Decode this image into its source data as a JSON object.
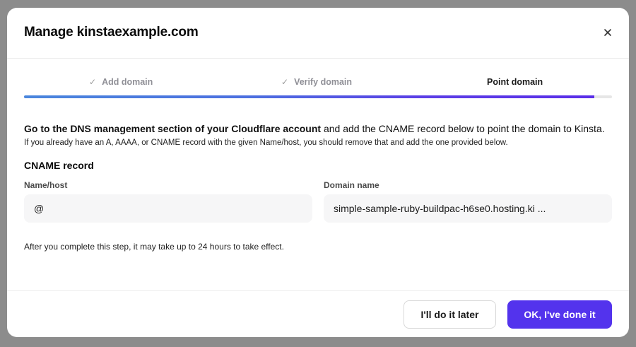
{
  "modal": {
    "title": "Manage kinstaexample.com",
    "close_icon": "close-icon"
  },
  "steps": [
    {
      "label": "Add domain",
      "status": "done",
      "icon": "checkmark-icon",
      "glyph": "✓"
    },
    {
      "label": "Verify domain",
      "status": "done",
      "icon": "checkmark-icon",
      "glyph": "✓"
    },
    {
      "label": "Point domain",
      "status": "active"
    }
  ],
  "progress": {
    "fraction": 0.97,
    "colors": [
      "#4a86dd",
      "#5a2ee8"
    ]
  },
  "instruction": {
    "bold": "Go to the DNS management section of your Cloudflare account",
    "rest": " and add the CNAME record below to point the domain to Kinsta.",
    "note": "If you already have an A, AAAA, or CNAME record with the given Name/host, you should remove that and add the one provided below."
  },
  "record": {
    "title": "CNAME record",
    "name_label": "Name/host",
    "name_value": "@",
    "domain_label": "Domain name",
    "domain_value": "simple-sample-ruby-buildpac-h6se0.hosting.ki ..."
  },
  "footnote": "After you complete this step, it may take up to 24 hours to take effect.",
  "footer": {
    "secondary_label": "I'll do it later",
    "primary_label": "OK, I've done it"
  },
  "colors": {
    "accent": "#5333ed",
    "overlay": "#8c8c8c"
  }
}
